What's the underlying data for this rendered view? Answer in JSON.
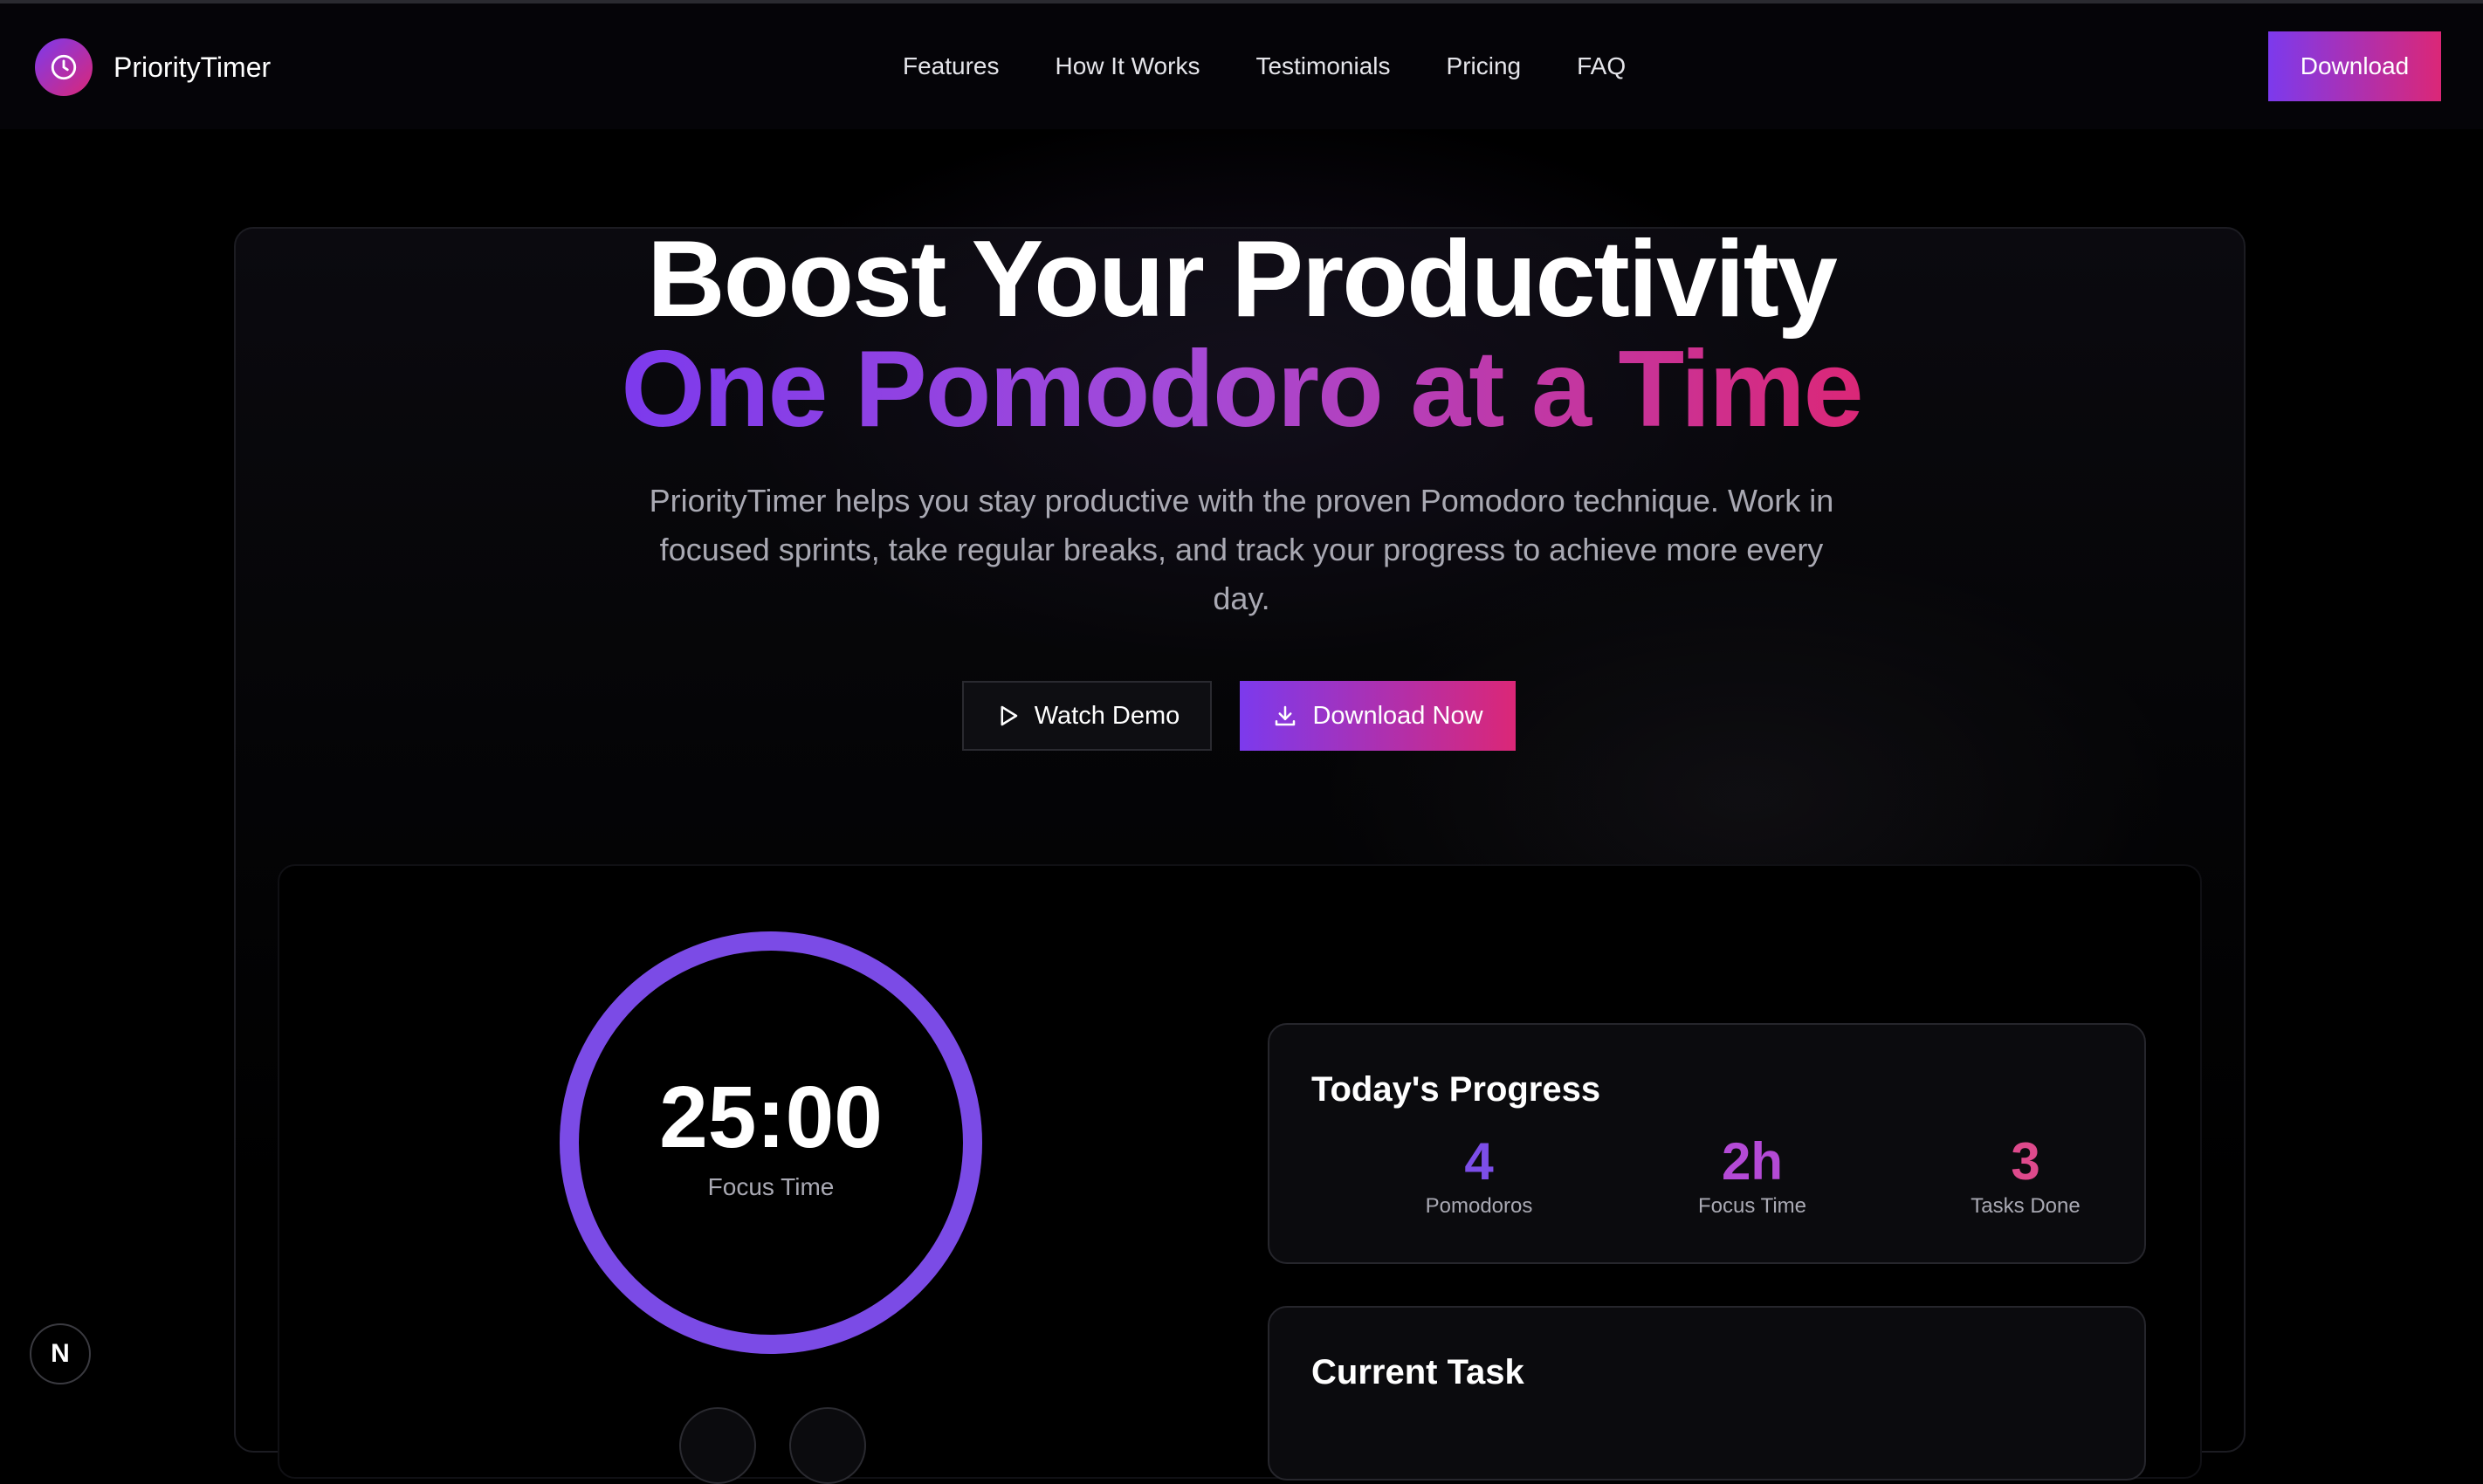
{
  "nav": {
    "brand": "PriorityTimer",
    "links": [
      "Features",
      "How It Works",
      "Testimonials",
      "Pricing",
      "FAQ"
    ],
    "download_label": "Download"
  },
  "hero": {
    "title_line1": "Boost Your Productivity",
    "title_line2": "One Pomodoro at a Time",
    "subtitle": "PriorityTimer helps you stay productive with the proven Pomodoro technique. Work in focused sprints, take regular breaks, and track your progress to achieve more every day.",
    "watch_demo_label": "Watch Demo",
    "download_now_label": "Download Now"
  },
  "timer": {
    "value": "25:00",
    "label": "Focus Time",
    "progress": 1.0
  },
  "progress_card": {
    "title": "Today's Progress",
    "stats": [
      {
        "value": "4",
        "label": "Pomodoros",
        "color": "#7c4ee8"
      },
      {
        "value": "2h",
        "label": "Focus Time",
        "color": "#b44ad6"
      },
      {
        "value": "3",
        "label": "Tasks Done",
        "color": "#de4a8c"
      }
    ]
  },
  "task_card": {
    "title": "Current Task"
  },
  "dev_badge": {
    "label": "N"
  },
  "colors": {
    "accent_purple": "#7c3aed",
    "accent_pink": "#db2777",
    "background": "#000000"
  }
}
